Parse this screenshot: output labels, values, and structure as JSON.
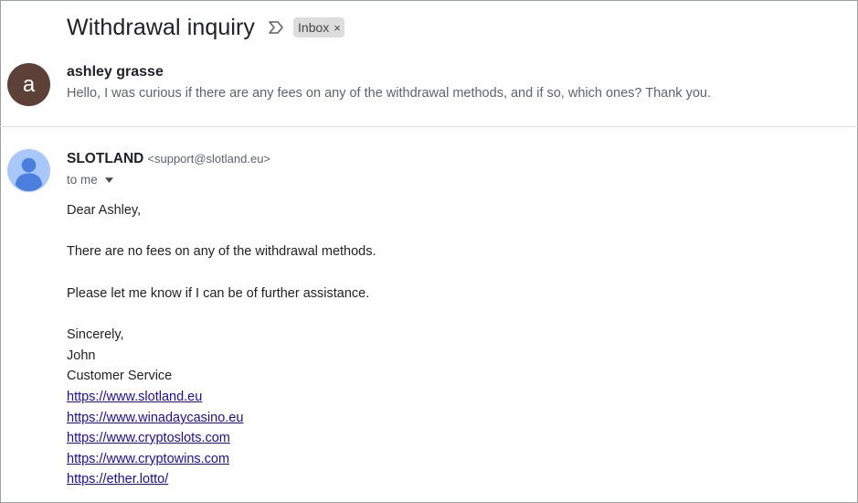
{
  "thread": {
    "subject": "Withdrawal inquiry",
    "label": "Inbox",
    "label_remove": "×"
  },
  "message1": {
    "avatar_letter": "a",
    "avatar_color": "#5d4037",
    "sender": "ashley grasse",
    "snippet": "Hello, I was curious if there are any fees on any of the withdrawal methods, and if so, which ones? Thank you."
  },
  "message2": {
    "sender": "SLOTLAND",
    "email": "<support@slotland.eu>",
    "recipient": "to me",
    "avatar_color": "#a8c7fa",
    "avatar_figure_color": "#4a7fe0",
    "body": {
      "greeting": "Dear Ashley,",
      "paragraph1": "There are no fees on any of the withdrawal methods.",
      "paragraph2": "Please let me know if I can be of further assistance.",
      "closing": "Sincerely,",
      "name": "John",
      "title": "Customer Service"
    },
    "links": [
      "https://www.slotland.eu",
      "https://www.winadaycasino.eu",
      "https://www.cryptoslots.com",
      "https://www.cryptowins.com",
      "https://ether.lotto/"
    ]
  }
}
